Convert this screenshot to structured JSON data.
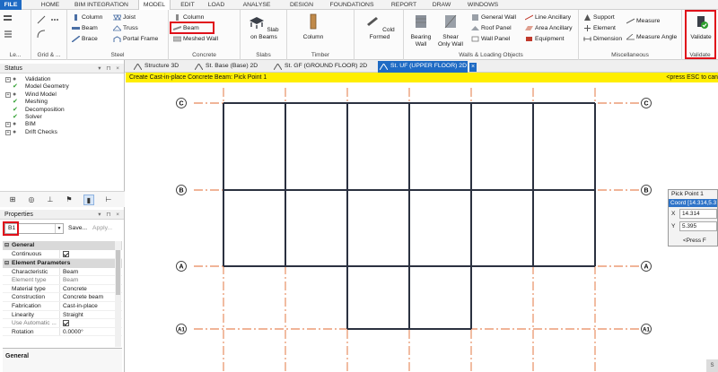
{
  "menu": {
    "tabs": [
      "FILE",
      "HOME",
      "BIM INTEGRATION",
      "MODEL",
      "EDIT",
      "LOAD",
      "ANALYSE",
      "DESIGN",
      "FOUNDATIONS",
      "REPORT",
      "DRAW",
      "WINDOWS"
    ],
    "active": "MODEL"
  },
  "ribbon": {
    "groups": {
      "levels": "Le...",
      "grid": "Grid & ...",
      "steel": "Steel",
      "concrete": "Concrete",
      "slabs": "Slabs",
      "timber": "Timber",
      "walls": "Walls & Loading Objects",
      "misc": "Miscellaneous"
    },
    "steel_items": {
      "column": "Column",
      "beam": "Beam",
      "brace": "Brace",
      "joist": "Joist",
      "truss": "Truss",
      "portal": "Portal Frame"
    },
    "concrete_items": {
      "column": "Column",
      "beam": "Beam",
      "meshed_wall": "Meshed Wall"
    },
    "slab_on_beams": "Slab on Beams",
    "timber_column": "Column",
    "cold_formed": "Cold Formed",
    "bearing_wall": "Bearing Wall",
    "shear_wall": "Shear Only Wall",
    "wall_items": {
      "general_wall": "General Wall",
      "roof_panel": "Roof Panel",
      "wall_panel": "Wall Panel",
      "line_anc": "Line Ancillary",
      "area_anc": "Area Ancillary",
      "equipment": "Equipment"
    },
    "misc_items": {
      "support": "Support",
      "element": "Element",
      "dimension": "Dimension",
      "measure": "Measure",
      "measure_angle": "Measure Angle"
    },
    "validate_button": "Validate",
    "validate_group": "Validate"
  },
  "doc_tabs": [
    "Structure 3D",
    "St. Base (Base) 2D",
    "St. GF (GROUND FLOOR) 2D",
    "St. UF (UPPER FLOOR) 2D"
  ],
  "status_panel": {
    "title": "Status",
    "items": [
      "Validation",
      "Model Geometry",
      "Wind Model",
      "Meshing",
      "Decomposition",
      "Solver",
      "BIM",
      "Drift Checks"
    ],
    "icons": [
      "q",
      "ok",
      "q",
      "ok",
      "ok",
      "ok",
      "q",
      "q"
    ]
  },
  "properties_panel": {
    "title": "Properties",
    "name_value": "B1",
    "save_label": "Save...",
    "apply_label": "Apply...",
    "cat_general": "General",
    "cat_element": "Element Parameters",
    "continuous_label": "Continuous",
    "rows": [
      {
        "k": "Characteristic",
        "v": "Beam"
      },
      {
        "k": "Element type",
        "v": "Beam"
      },
      {
        "k": "Material type",
        "v": "Concrete"
      },
      {
        "k": "Construction",
        "v": "Concrete beam"
      },
      {
        "k": "Fabrication",
        "v": "Cast-in-place"
      },
      {
        "k": "Linearity",
        "v": "Straight"
      }
    ],
    "use_auto_label": "Use Automatic ...",
    "rotation_label": "Rotation",
    "rotation_value": "0.0000°",
    "footer": "General"
  },
  "command_bar": {
    "prompt": "Create Cast-in-place Concrete Beam: Pick Point 1",
    "hint": "<press ESC to can"
  },
  "grid_labels": {
    "c": "C",
    "b": "B",
    "a": "A",
    "a1": "A1"
  },
  "pick_dialog": {
    "title": "Pick Point 1",
    "coord": "Coord [14.314,5.3",
    "x_label": "X",
    "x_value": "14.314",
    "y_label": "Y",
    "y_value": "5.395",
    "ok": "<Press F"
  },
  "corner_label": "S",
  "colors": {
    "accent": "#1f6bc4",
    "highlight": "#e0101a",
    "command_bar": "#ffee00",
    "grid_line": "#e06a30",
    "beam": "#2b3140"
  }
}
